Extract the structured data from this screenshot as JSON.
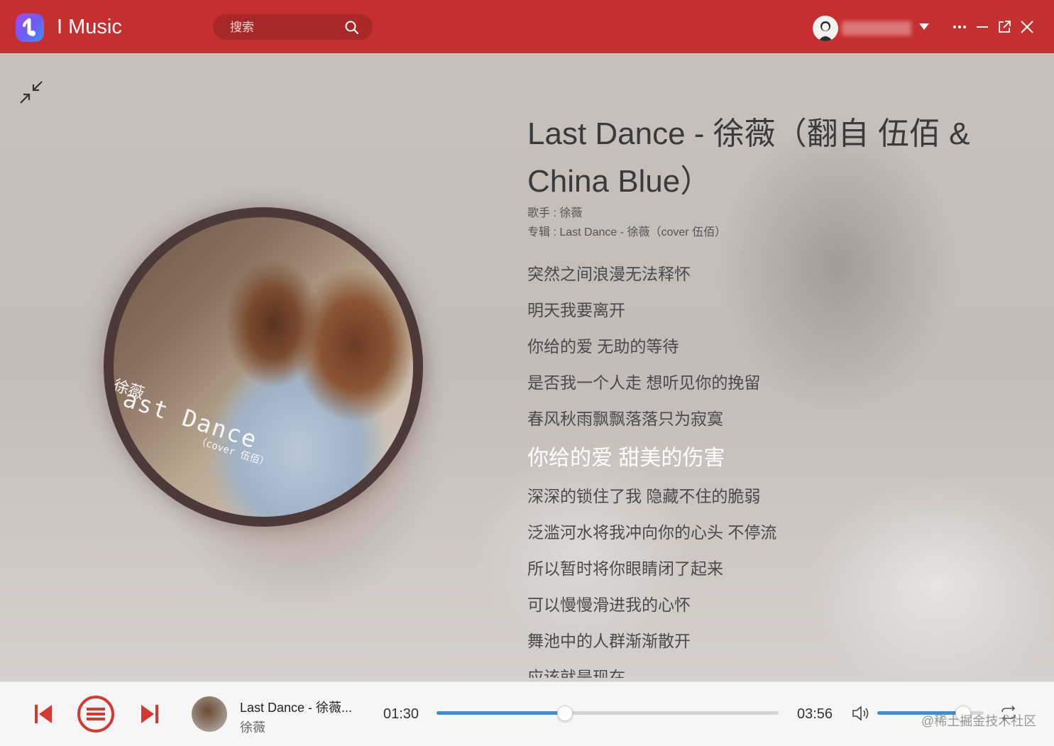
{
  "header": {
    "app_title": "I Music",
    "search_placeholder": "搜索"
  },
  "song": {
    "title": "Last Dance - 徐薇（翻自 伍佰 & China Blue）",
    "singer_line": "歌手 : 徐薇",
    "album_line": "专辑 : Last Dance - 徐薇（cover 伍佰）"
  },
  "cover": {
    "artist_text": "徐薇",
    "title_text": "ast  Dance",
    "sub_text": "（cover 伍佰）"
  },
  "lyrics": [
    {
      "text": "突然之间浪漫无法释怀",
      "active": false
    },
    {
      "text": "明天我要离开",
      "active": false
    },
    {
      "text": "你给的爱 无助的等待",
      "active": false
    },
    {
      "text": "是否我一个人走 想听见你的挽留",
      "active": false
    },
    {
      "text": "春风秋雨飘飘落落只为寂寞",
      "active": false
    },
    {
      "text": "你给的爱 甜美的伤害",
      "active": true
    },
    {
      "text": "深深的锁住了我 隐藏不住的脆弱",
      "active": false
    },
    {
      "text": "泛滥河水将我冲向你的心头 不停流",
      "active": false
    },
    {
      "text": "所以暂时将你眼睛闭了起来",
      "active": false
    },
    {
      "text": "可以慢慢滑进我的心怀",
      "active": false
    },
    {
      "text": "舞池中的人群渐渐散开",
      "active": false
    },
    {
      "text": "应该就是现在",
      "active": false
    }
  ],
  "player": {
    "now_title": "Last Dance - 徐薇...",
    "now_artist": "徐薇",
    "current_time": "01:30",
    "total_time": "03:56",
    "progress_fraction": 0.374,
    "volume_fraction": 0.8,
    "watermark": "@稀土掘金技术社区"
  },
  "colors": {
    "header_bg": "#c62f2f",
    "accent_red": "#d33a31",
    "progress_blue": "#3c8fd6"
  }
}
